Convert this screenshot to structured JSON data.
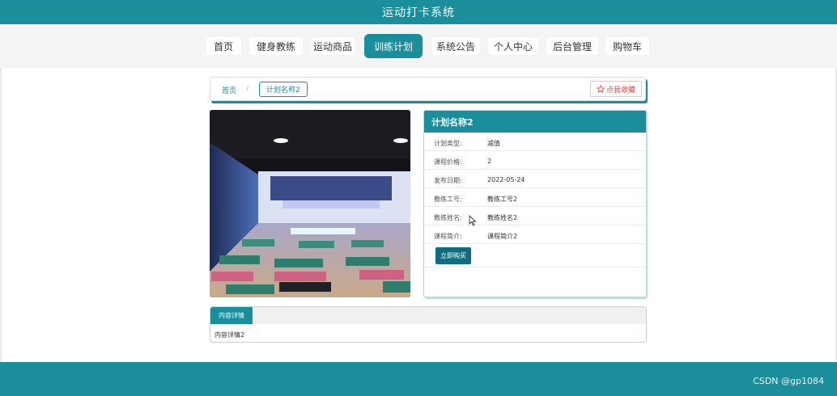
{
  "site": {
    "title": "运动打卡系统"
  },
  "nav": {
    "items": [
      {
        "label": "首页",
        "active": false
      },
      {
        "label": "健身教练",
        "active": false
      },
      {
        "label": "运动商品",
        "active": false
      },
      {
        "label": "训练计划",
        "active": true
      },
      {
        "label": "系统公告",
        "active": false
      },
      {
        "label": "个人中心",
        "active": false
      },
      {
        "label": "后台管理",
        "active": false
      },
      {
        "label": "购物车",
        "active": false
      }
    ]
  },
  "breadcrumb": {
    "home": "首页",
    "separator": "/",
    "current": "计划名称2"
  },
  "favorite": {
    "label": "点我收藏",
    "icon": "star-outline-icon"
  },
  "detail": {
    "title": "计划名称2",
    "rows": [
      {
        "label": "计划类型:",
        "value": "减值"
      },
      {
        "label": "课程价格:",
        "value": "2"
      },
      {
        "label": "发布日期:",
        "value": "2022-05-24"
      },
      {
        "label": "教练工号:",
        "value": "教练工号2"
      },
      {
        "label": "教练姓名:",
        "value": "教练姓名2"
      },
      {
        "label": "课程简介:",
        "value": "课程简介2"
      }
    ],
    "buy_label": "立即购买"
  },
  "tabs": {
    "active_label": "内容详情",
    "content": "内容详情2"
  },
  "watermark": "CSDN @gp1084",
  "colors": {
    "primary": "#1a8e9b",
    "buy_button": "#0e6e80",
    "favorite": "#e04848"
  }
}
